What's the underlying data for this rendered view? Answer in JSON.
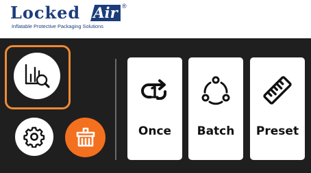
{
  "brand": {
    "name": "Locked",
    "name_suffix": "Air",
    "registered_mark": "®",
    "tagline": "Inflatable Protective Packaging Solutions"
  },
  "colors": {
    "accent": "#ef8a33",
    "clean_button": "#f3701f",
    "panel_background": "#1f1f1f",
    "brand_blue": "#1c3d7a"
  },
  "icons": {
    "analytics": "bar-chart-magnifier-icon",
    "settings": "gear-icon",
    "clean": "basket-icon",
    "once": "repeat-once-icon",
    "batch": "cycle-nodes-icon",
    "preset": "ruler-icon"
  },
  "modes": [
    {
      "label": "Once",
      "icon": "repeat-once-icon"
    },
    {
      "label": "Batch",
      "icon": "cycle-nodes-icon"
    },
    {
      "label": "Preset",
      "icon": "ruler-icon"
    }
  ]
}
